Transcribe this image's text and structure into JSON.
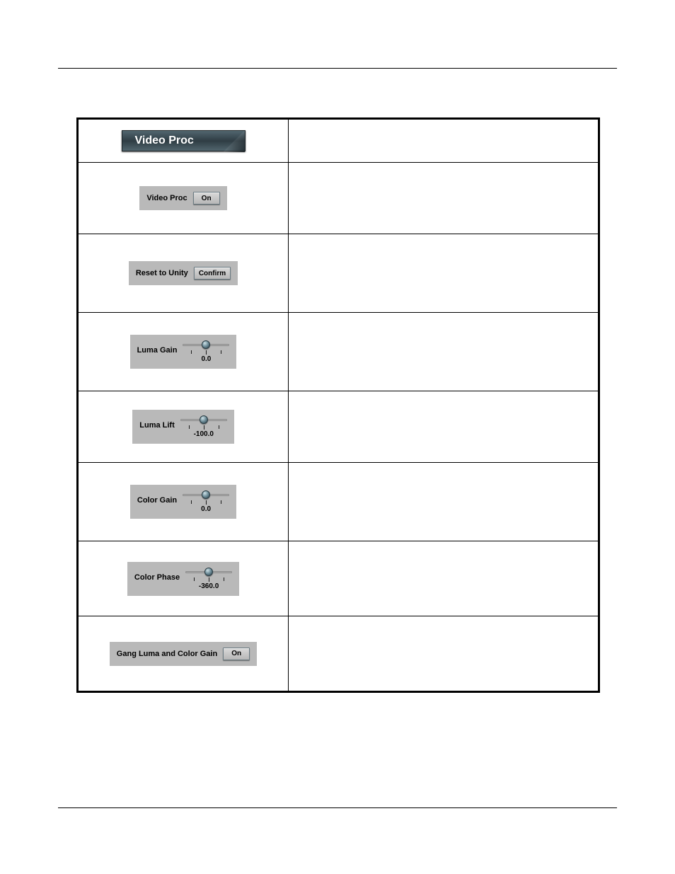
{
  "header_tab": {
    "label": "Video Proc"
  },
  "rows": {
    "video_proc": {
      "label": "Video Proc",
      "button": "On"
    },
    "reset_to_unity": {
      "label": "Reset to Unity",
      "button": "Confirm"
    },
    "luma_gain": {
      "label": "Luma Gain",
      "value": "0.0"
    },
    "luma_lift": {
      "label": "Luma Lift",
      "value": "-100.0"
    },
    "color_gain": {
      "label": "Color Gain",
      "value": "0.0"
    },
    "color_phase": {
      "label": "Color Phase",
      "value": "-360.0"
    },
    "gang": {
      "label": "Gang Luma and Color Gain",
      "button": "On"
    }
  }
}
